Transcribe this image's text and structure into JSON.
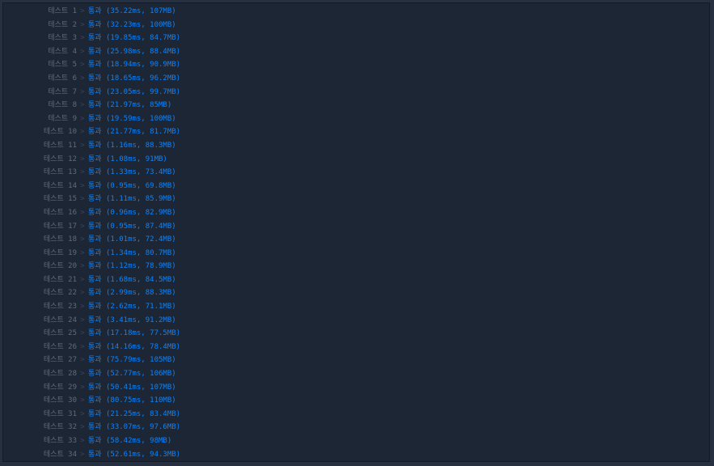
{
  "results": {
    "separator": ">",
    "rows": [
      {
        "label": "테스트 1",
        "result": "통과 (35.22ms, 107MB)"
      },
      {
        "label": "테스트 2",
        "result": "통과 (32.23ms, 100MB)"
      },
      {
        "label": "테스트 3",
        "result": "통과 (19.85ms, 84.7MB)"
      },
      {
        "label": "테스트 4",
        "result": "통과 (25.98ms, 88.4MB)"
      },
      {
        "label": "테스트 5",
        "result": "통과 (18.94ms, 90.9MB)"
      },
      {
        "label": "테스트 6",
        "result": "통과 (18.65ms, 96.2MB)"
      },
      {
        "label": "테스트 7",
        "result": "통과 (23.05ms, 99.7MB)"
      },
      {
        "label": "테스트 8",
        "result": "통과 (21.97ms, 85MB)"
      },
      {
        "label": "테스트 9",
        "result": "통과 (19.59ms, 100MB)"
      },
      {
        "label": "테스트 10",
        "result": "통과 (21.77ms, 81.7MB)"
      },
      {
        "label": "테스트 11",
        "result": "통과 (1.16ms, 88.3MB)"
      },
      {
        "label": "테스트 12",
        "result": "통과 (1.08ms, 91MB)"
      },
      {
        "label": "테스트 13",
        "result": "통과 (1.33ms, 73.4MB)"
      },
      {
        "label": "테스트 14",
        "result": "통과 (0.95ms, 69.8MB)"
      },
      {
        "label": "테스트 15",
        "result": "통과 (1.11ms, 85.9MB)"
      },
      {
        "label": "테스트 16",
        "result": "통과 (0.96ms, 82.9MB)"
      },
      {
        "label": "테스트 17",
        "result": "통과 (0.95ms, 87.4MB)"
      },
      {
        "label": "테스트 18",
        "result": "통과 (1.01ms, 72.4MB)"
      },
      {
        "label": "테스트 19",
        "result": "통과 (1.34ms, 80.7MB)"
      },
      {
        "label": "테스트 20",
        "result": "통과 (1.12ms, 78.9MB)"
      },
      {
        "label": "테스트 21",
        "result": "통과 (1.68ms, 84.5MB)"
      },
      {
        "label": "테스트 22",
        "result": "통과 (2.99ms, 88.3MB)"
      },
      {
        "label": "테스트 23",
        "result": "통과 (2.62ms, 71.1MB)"
      },
      {
        "label": "테스트 24",
        "result": "통과 (3.41ms, 91.2MB)"
      },
      {
        "label": "테스트 25",
        "result": "통과 (17.18ms, 77.5MB)"
      },
      {
        "label": "테스트 26",
        "result": "통과 (14.16ms, 78.4MB)"
      },
      {
        "label": "테스트 27",
        "result": "통과 (75.79ms, 105MB)"
      },
      {
        "label": "테스트 28",
        "result": "통과 (52.77ms, 106MB)"
      },
      {
        "label": "테스트 29",
        "result": "통과 (50.41ms, 107MB)"
      },
      {
        "label": "테스트 30",
        "result": "통과 (80.75ms, 110MB)"
      },
      {
        "label": "테스트 31",
        "result": "통과 (21.25ms, 83.4MB)"
      },
      {
        "label": "테스트 32",
        "result": "통과 (33.07ms, 97.6MB)"
      },
      {
        "label": "테스트 33",
        "result": "통과 (58.42ms, 98MB)"
      },
      {
        "label": "테스트 34",
        "result": "통과 (52.61ms, 94.3MB)"
      }
    ]
  },
  "colors": {
    "label": "#5f6b7c",
    "result": "#0a84ff",
    "panel_background": "#1d2635"
  }
}
